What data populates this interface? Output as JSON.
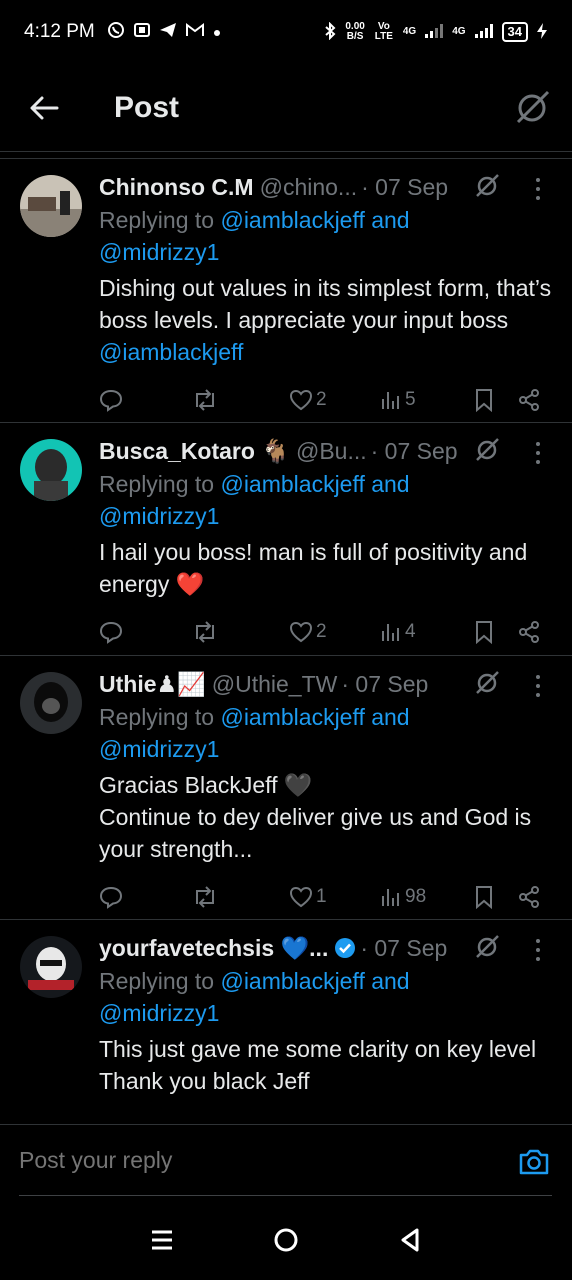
{
  "status_bar": {
    "time": "4:12 PM",
    "net_speed": "0.00",
    "net_unit": "B/S",
    "volte": "Vo LTE",
    "net_type1": "4G",
    "net_type2": "4G",
    "battery": "34",
    "left_icons": [
      "whatsapp-icon",
      "app-icon",
      "telegram-icon",
      "gmail-icon",
      "dot-icon"
    ]
  },
  "header": {
    "title": "Post"
  },
  "replies": [
    {
      "name": "Chinonso C.M",
      "handle": "@chino...",
      "date": "· 07 Sep",
      "replying_prefix": "Replying to ",
      "replying_to_1": "@iamblackjeff and",
      "replying_to_2": "@midrizzy1",
      "text": "Dishing out values in its simplest form, that’s boss levels. I appreciate your input boss ",
      "text_mention": "@iamblackjeff",
      "likes": "2",
      "views": "5"
    },
    {
      "name": "Busca_Kotaro 🐐",
      "handle": "@Bu...",
      "date": "· 07 Sep",
      "replying_prefix": "Replying to ",
      "replying_to_1": "@iamblackjeff and",
      "replying_to_2": "@midrizzy1",
      "text": "I hail you boss! man is full of positivity and energy ❤️",
      "likes": "2",
      "views": "4"
    },
    {
      "name": "Uthie♟📈",
      "handle": "@Uthie_TW",
      "date": "· 07 Sep",
      "replying_prefix": "Replying to ",
      "replying_to_1": "@iamblackjeff and",
      "replying_to_2": "@midrizzy1",
      "text_line1": "Gracias BlackJeff 🖤",
      "text_line2": "Continue to dey deliver give us and God is your strength...",
      "likes": "1",
      "views": "98"
    },
    {
      "name": "yourfavetechsis 💙...",
      "date": "· 07 Sep",
      "replying_prefix": "Replying to ",
      "replying_to_1": "@iamblackjeff and",
      "replying_to_2": "@midrizzy1",
      "text_line1": "This just gave me some clarity on key level",
      "text_line2": "Thank you black Jeff"
    }
  ],
  "reply_box": {
    "placeholder": "Post your reply"
  },
  "colors": {
    "accent": "#1d9bf0",
    "muted": "#71767b",
    "text": "#e7e9ea",
    "heart": "#e0245e"
  }
}
